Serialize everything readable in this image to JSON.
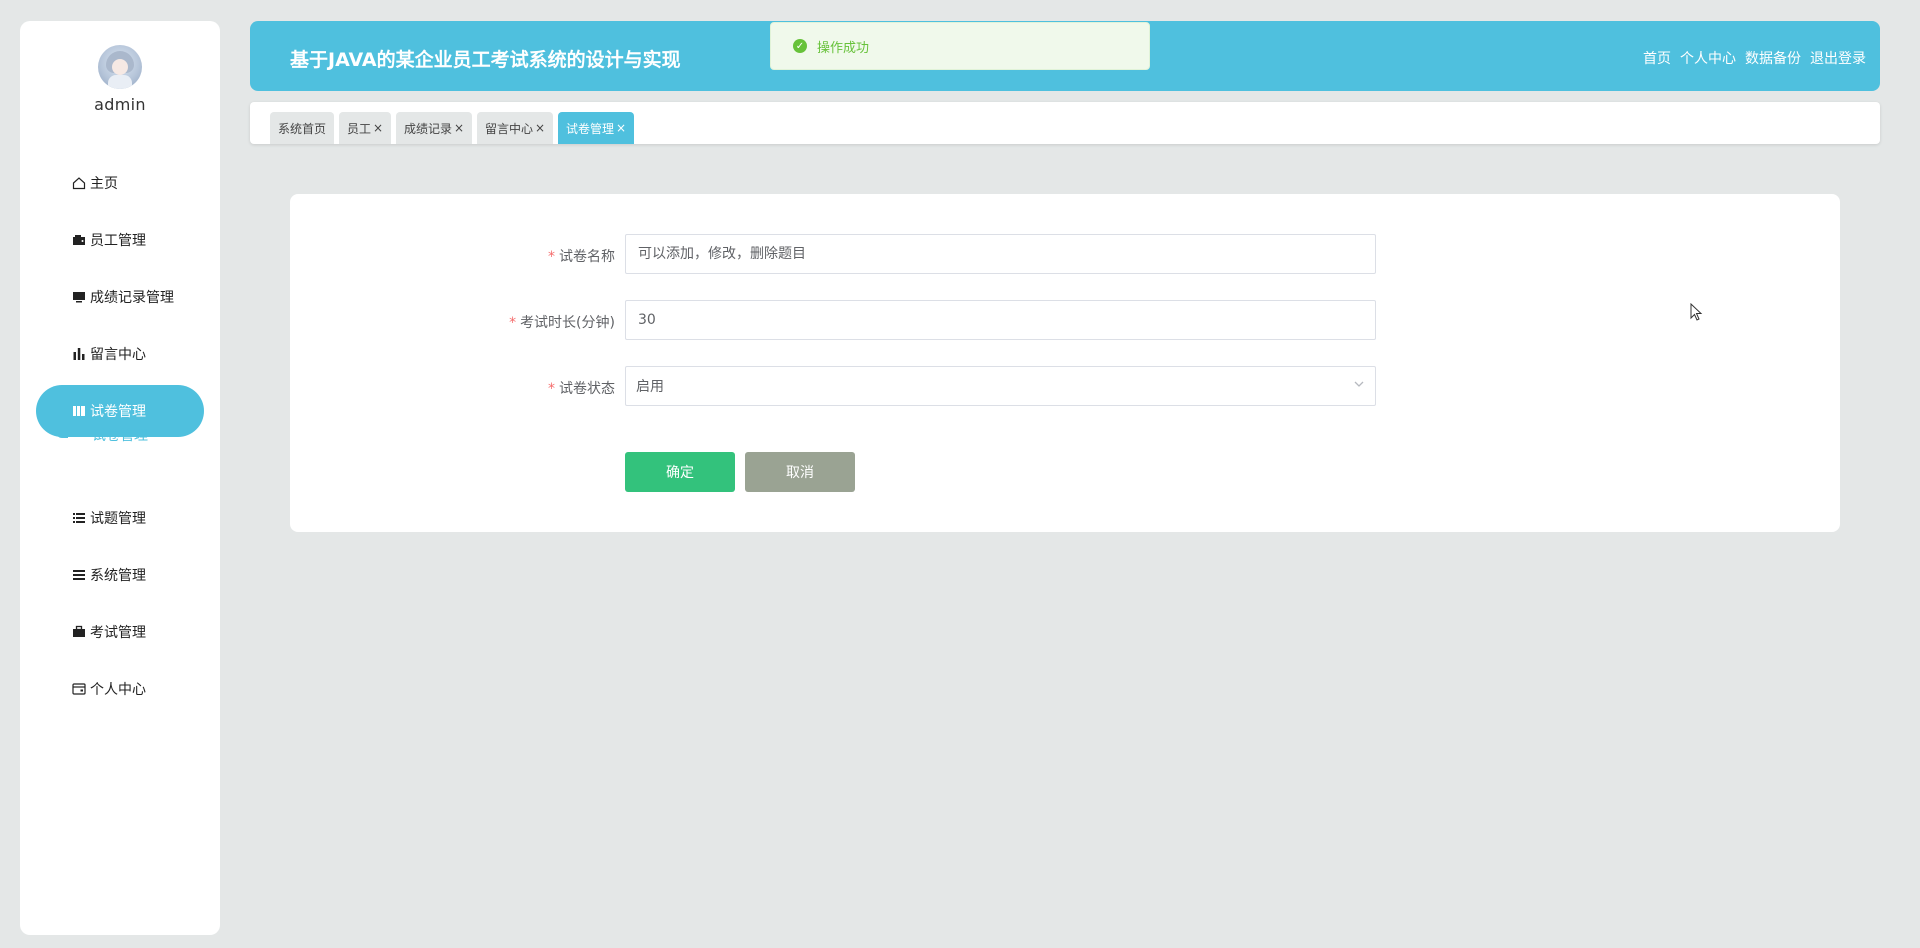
{
  "app": {
    "title": "基于JAVA的某企业员工考试系统的设计与实现",
    "accent_color": "#4fc0de"
  },
  "user": {
    "name": "admin"
  },
  "top_nav": [
    "首页",
    "个人中心",
    "数据备份",
    "退出登录"
  ],
  "toast": {
    "message": "操作成功",
    "type": "success",
    "icon": "check-circle-icon"
  },
  "sidebar": {
    "items": [
      {
        "label": "主页",
        "icon": "home-icon"
      },
      {
        "label": "员工管理",
        "icon": "wallet-icon"
      },
      {
        "label": "成绩记录管理",
        "icon": "monitor-icon"
      },
      {
        "label": "留言中心",
        "icon": "bar-chart-icon"
      },
      {
        "label": "试卷管理",
        "icon": "book-icon",
        "active": true
      },
      {
        "label": "试题管理",
        "icon": "list-icon"
      },
      {
        "label": "系统管理",
        "icon": "menu-icon"
      },
      {
        "label": "考试管理",
        "icon": "briefcase-icon"
      },
      {
        "label": "个人中心",
        "icon": "card-icon"
      }
    ],
    "submenu": {
      "label": "试卷管理"
    }
  },
  "tags": [
    {
      "label": "系统首页",
      "closable": false
    },
    {
      "label": "员工",
      "closable": true
    },
    {
      "label": "成绩记录",
      "closable": true
    },
    {
      "label": "留言中心",
      "closable": true
    },
    {
      "label": "试卷管理",
      "closable": true,
      "active": true
    }
  ],
  "tag_close_glyph": "×",
  "form": {
    "fields": [
      {
        "label": "试卷名称",
        "required": true,
        "value": "",
        "placeholder": "可以添加，修改，删除题目"
      },
      {
        "label": "考试时长(分钟)",
        "required": true,
        "value": "30",
        "placeholder": ""
      },
      {
        "label": "试卷状态",
        "required": true,
        "value": "启用",
        "type": "select"
      }
    ],
    "confirm_label": "确定",
    "cancel_label": "取消"
  }
}
